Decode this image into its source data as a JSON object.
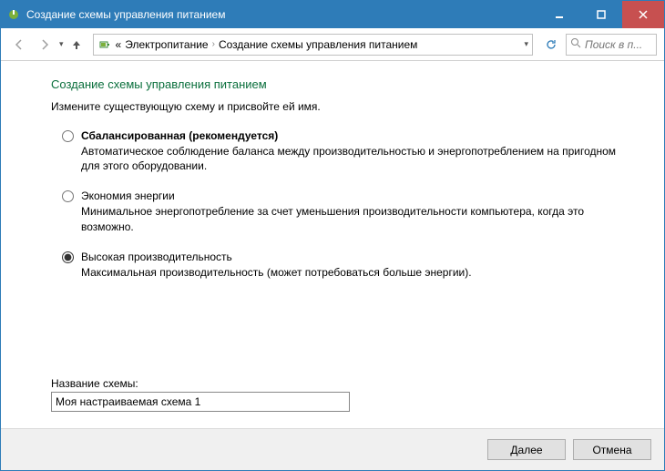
{
  "window": {
    "title": "Создание схемы управления питанием"
  },
  "nav": {
    "breadcrumb_prefix": "«",
    "breadcrumb_root": "Электропитание",
    "breadcrumb_current": "Создание схемы управления питанием",
    "search_placeholder": "Поиск в п..."
  },
  "main": {
    "heading": "Создание схемы управления питанием",
    "instruction": "Измените существующую схему и присвойте ей имя.",
    "options": [
      {
        "title": "Сбалансированная (рекомендуется)",
        "desc": "Автоматическое соблюдение баланса между производительностью и энергопотреблением на пригодном для этого оборудовании.",
        "bold": true,
        "checked": false
      },
      {
        "title": "Экономия энергии",
        "desc": "Минимальное энергопотребление за счет уменьшения производительности компьютера, когда это возможно.",
        "bold": false,
        "checked": false
      },
      {
        "title": "Высокая производительность",
        "desc": "Максимальная производительность (может потребоваться больше энергии).",
        "bold": false,
        "checked": true
      }
    ],
    "name_label": "Название схемы:",
    "name_value": "Моя настраиваемая схема 1"
  },
  "footer": {
    "next": "Далее",
    "cancel": "Отмена"
  }
}
